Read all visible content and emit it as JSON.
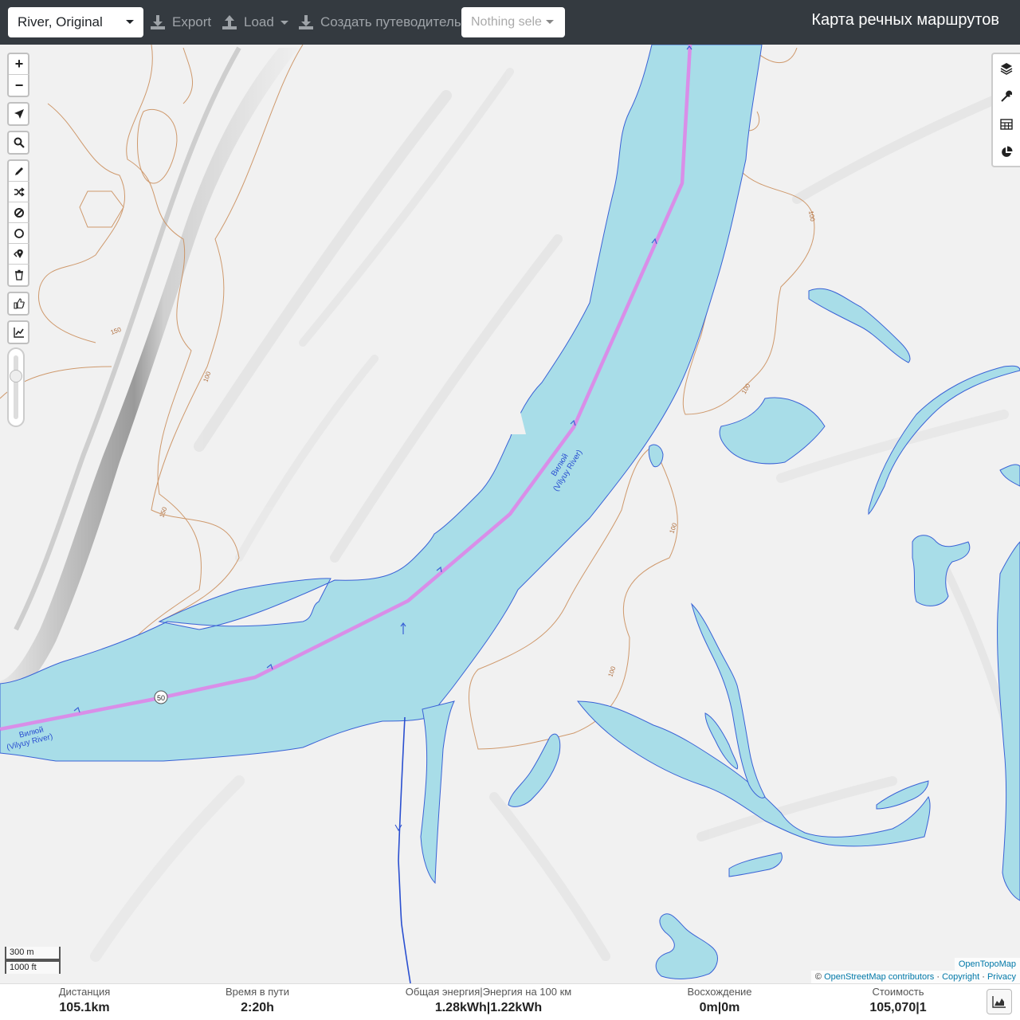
{
  "navbar": {
    "profile": "River, Original",
    "export_label": "Export",
    "load_label": "Load",
    "guide_label": "Создать путеводитель",
    "selection_placeholder": "Nothing sele",
    "brand": "Карта речных маршрутов"
  },
  "map": {
    "controls": [
      "zoom-in",
      "zoom-out",
      "locate",
      "search",
      "draw",
      "reroute",
      "no-go",
      "circle",
      "poi",
      "delete",
      "thumbs-up",
      "elevation-chart"
    ],
    "zoom_in": "+",
    "zoom_out": "−",
    "right_controls": [
      "layers",
      "tools",
      "table",
      "chart"
    ],
    "river_label_main": "Вилюй",
    "river_label_sub": "(Vilyuy River)",
    "route_shield": "50",
    "contour_labels": [
      "100",
      "150"
    ],
    "scale_metric": "300 m",
    "scale_imperial": "1000 ft",
    "attribution": {
      "tiles": "OpenTopoMap",
      "prefix": "©",
      "osm": "OpenStreetMap contributors",
      "copyright": "Copyright",
      "privacy": "Privacy",
      "sep": "·"
    },
    "colors": {
      "water": "#a8dde8",
      "water_stroke": "#3a62d6",
      "route": "#d98ee8",
      "contour": "#c98a55",
      "terrain": "#f2f2f2"
    }
  },
  "stats": {
    "distance_label": "Дистанция",
    "distance_value": "105.1",
    "distance_unit": "km",
    "time_label": "Время в пути",
    "time_value": "2:20",
    "time_unit": "h",
    "energy_label": "Общая энергия",
    "energy100_label": "Энергия на 100 км",
    "energy_value": "1.28",
    "energy_unit": "kWh",
    "energy100_value": "1.22",
    "energy100_unit": "kWh",
    "ascent_label": "Восхождение",
    "ascent_up": "0",
    "ascent_down": "0",
    "ascent_unit": "m",
    "cost_label": "Стоимость",
    "cost_value": "105,070",
    "cost_factor": "1",
    "sep": "|"
  }
}
